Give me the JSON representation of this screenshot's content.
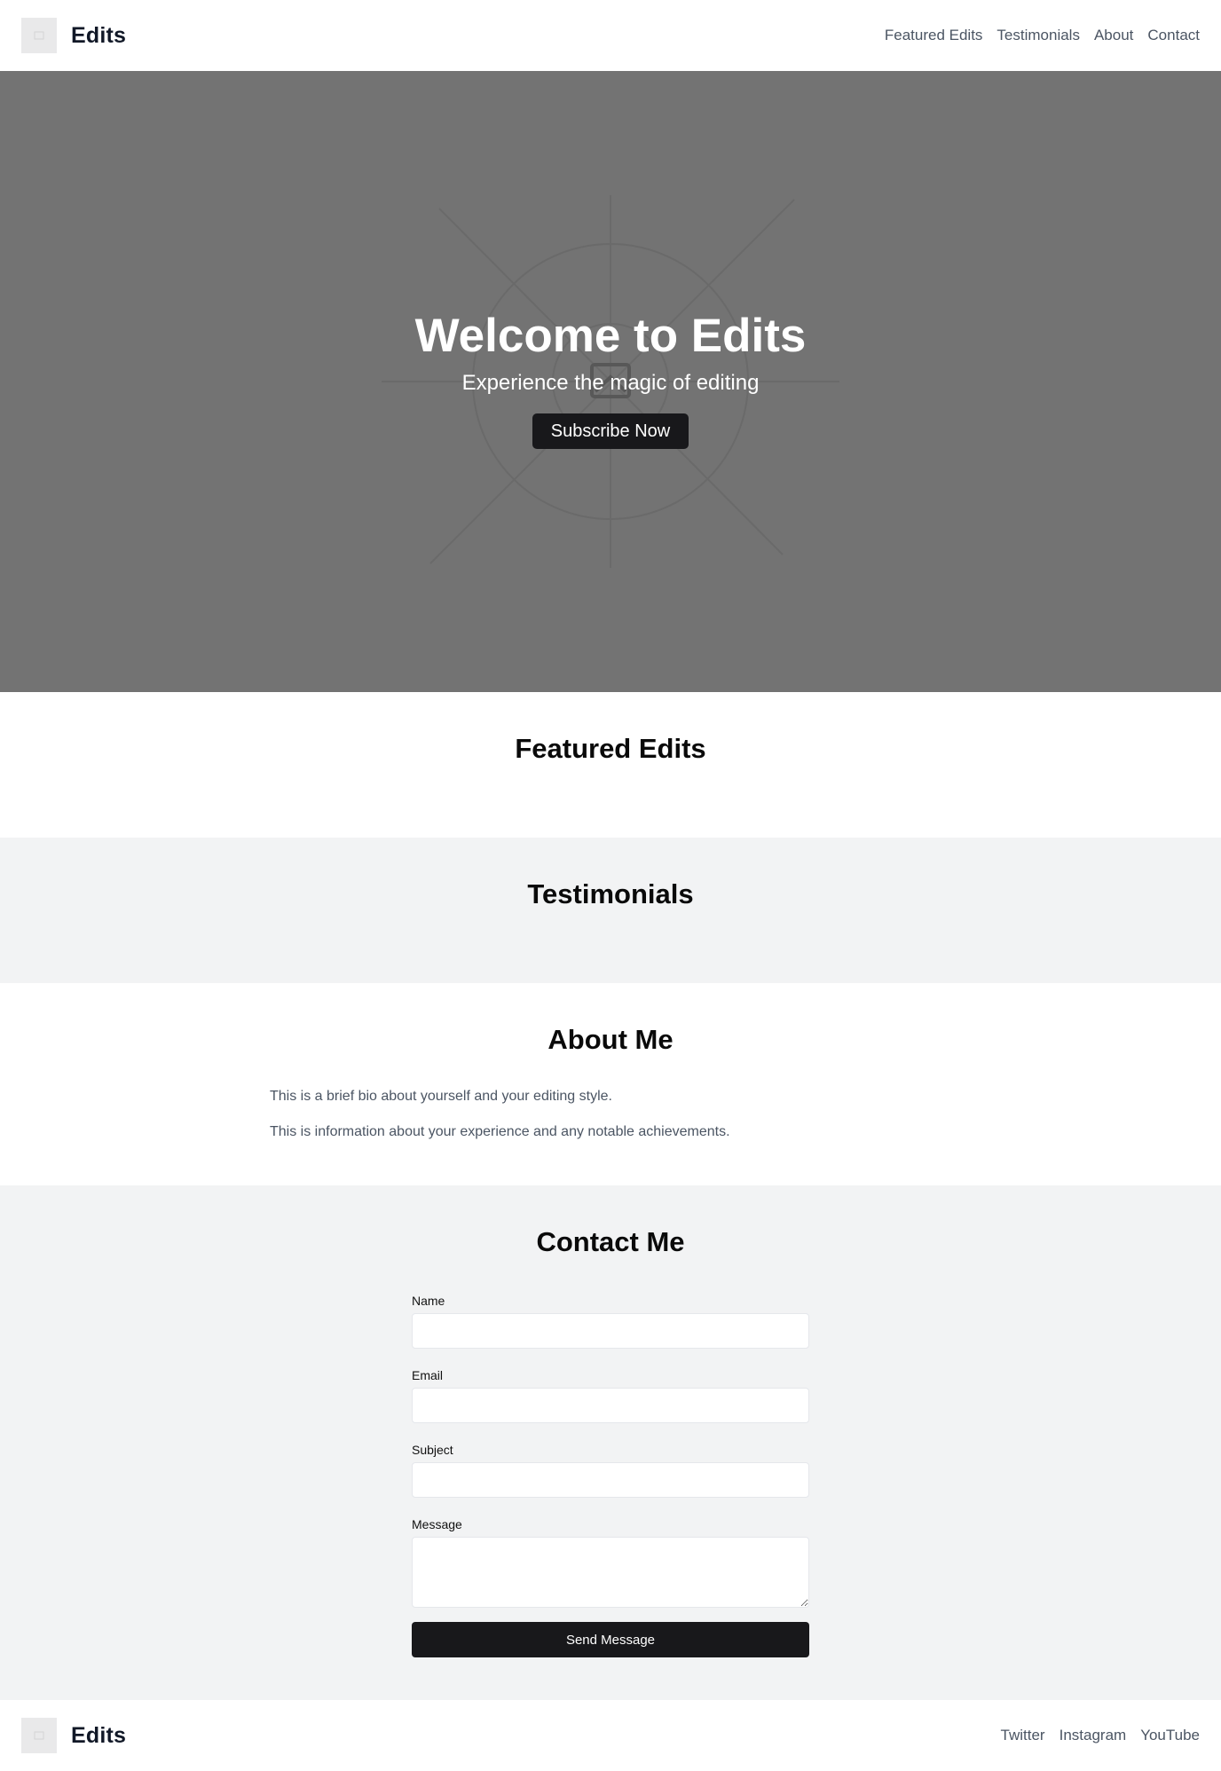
{
  "header": {
    "brand": "Edits",
    "logo_icon": "image-placeholder-icon",
    "nav": [
      "Featured Edits",
      "Testimonials",
      "About",
      "Contact"
    ]
  },
  "hero": {
    "title": "Welcome to Edits",
    "subtitle": "Experience the magic of editing",
    "cta": "Subscribe Now",
    "background_icon": "image-placeholder-icon",
    "background_color": "#737373"
  },
  "featured": {
    "heading": "Featured Edits"
  },
  "testimonials": {
    "heading": "Testimonials"
  },
  "about": {
    "heading": "About Me",
    "paragraphs": [
      "This is a brief bio about yourself and your editing style.",
      "This is information about your experience and any notable achievements."
    ]
  },
  "contact": {
    "heading": "Contact Me",
    "fields": {
      "name": {
        "label": "Name",
        "value": "",
        "placeholder": ""
      },
      "email": {
        "label": "Email",
        "value": "",
        "placeholder": ""
      },
      "subject": {
        "label": "Subject",
        "value": "",
        "placeholder": ""
      },
      "message": {
        "label": "Message",
        "value": "",
        "placeholder": ""
      }
    },
    "submit": "Send Message"
  },
  "footer": {
    "brand": "Edits",
    "links": [
      "Twitter",
      "Instagram",
      "YouTube"
    ]
  },
  "colors": {
    "accent_dark": "#18181b",
    "alt_section_bg": "#f2f3f4",
    "muted_text": "#4b5563"
  }
}
